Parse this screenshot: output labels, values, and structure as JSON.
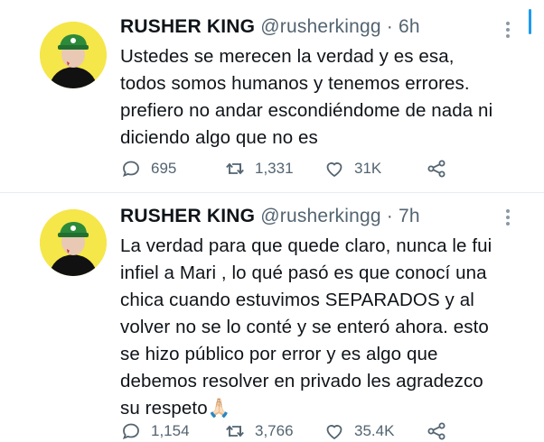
{
  "colors": {
    "accent": "#1d9bf0",
    "text": "#0f1419",
    "muted": "#536471",
    "avatar_bg": "#f5e64a"
  },
  "tweets": [
    {
      "name": "RUSHER KING",
      "handle": "@rusherkingg",
      "dot": "·",
      "time": "6h",
      "lines": [
        "Ustedes se merecen la verdad y es esa,",
        "todos somos humanos y tenemos errores.",
        "prefiero no andar escondiéndome de nada ni",
        "diciendo algo que no es"
      ],
      "replies": "695",
      "retweets": "1,331",
      "likes": "31K"
    },
    {
      "name": "RUSHER KING",
      "handle": "@rusherkingg",
      "dot": "·",
      "time": "7h",
      "lines": [
        "La verdad para que quede claro, nunca le fui",
        "infiel a Mari , lo qué pasó es que conocí una",
        "chica cuando estuvimos SEPARADOS y al",
        "volver no se lo conté y se enteró ahora. esto",
        "se hizo público por error y es algo que",
        "debemos resolver en privado les agradezco",
        "su respeto🙏🏻"
      ],
      "replies": "1,154",
      "retweets": "3,766",
      "likes": "35.4K"
    }
  ]
}
